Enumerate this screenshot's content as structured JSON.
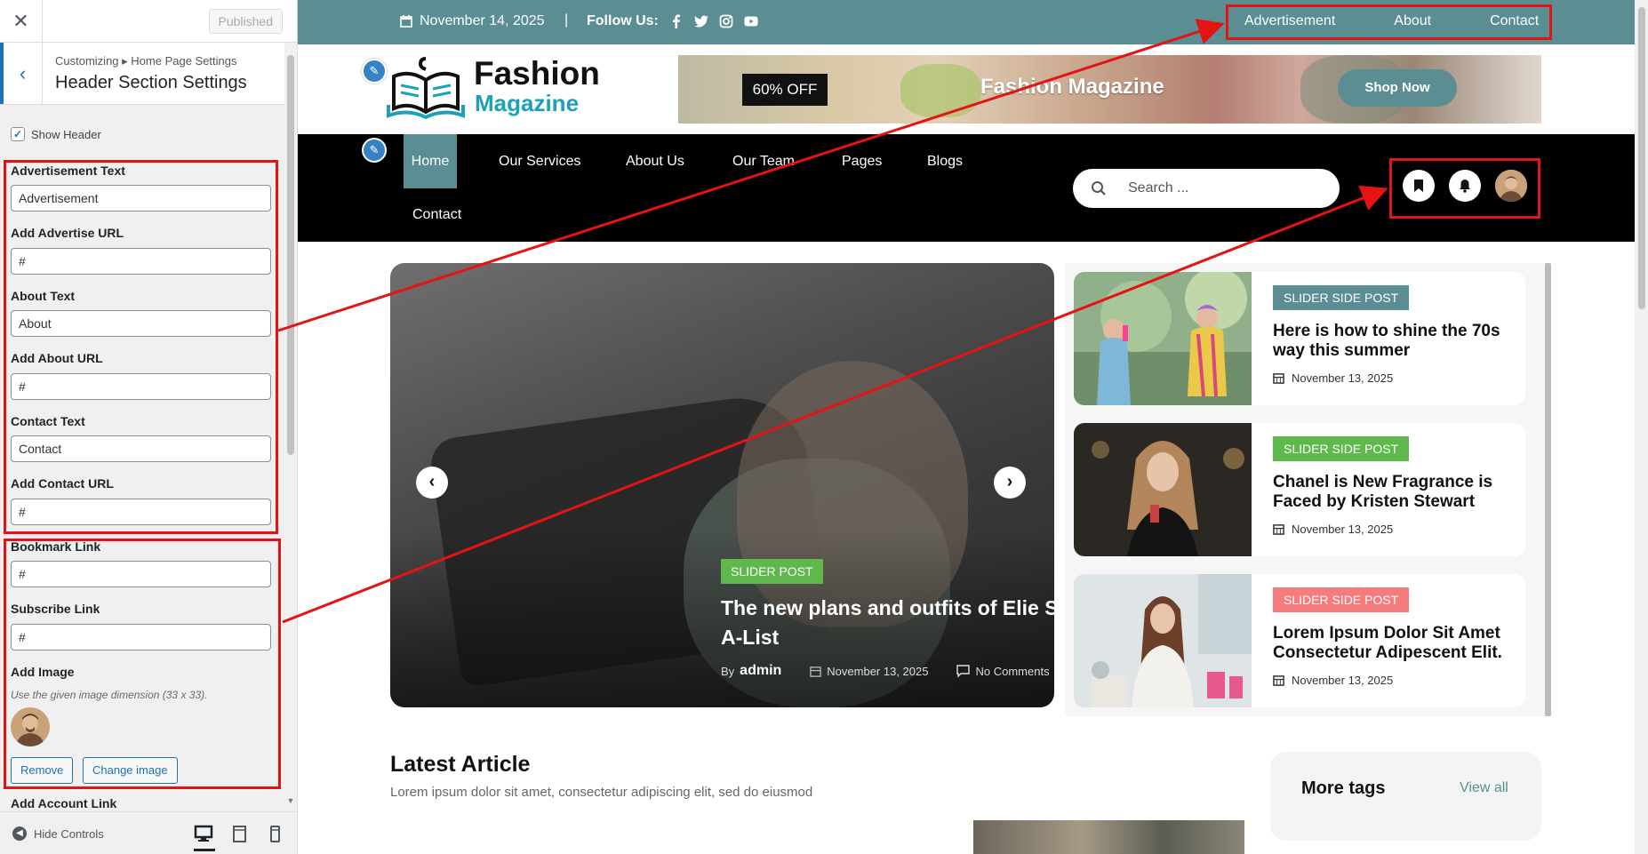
{
  "customizer": {
    "close_icon": "close-icon",
    "published_label": "Published",
    "breadcrumb": "Customizing ▸ Home Page Settings",
    "section_title": "Header Section Settings",
    "show_header_label": "Show Header",
    "fields": {
      "advertisement_text_label": "Advertisement Text",
      "advertisement_text_value": "Advertisement",
      "advertise_url_label": "Add Advertise URL",
      "advertise_url_value": "#",
      "about_text_label": "About Text",
      "about_text_value": "About",
      "about_url_label": "Add About URL",
      "about_url_value": "#",
      "contact_text_label": "Contact Text",
      "contact_text_value": "Contact",
      "contact_url_label": "Add Contact URL",
      "contact_url_value": "#",
      "bookmark_link_label": "Bookmark Link",
      "bookmark_link_value": "#",
      "subscribe_link_label": "Subscribe Link",
      "subscribe_link_value": "#",
      "add_image_label": "Add Image",
      "add_image_desc": "Use the given image dimension (33 x 33).",
      "remove_label": "Remove",
      "change_image_label": "Change image",
      "account_link_label": "Add Account Link"
    },
    "hide_controls_label": "Hide Controls"
  },
  "site": {
    "topbar": {
      "date": "November 14, 2025",
      "separator": "|",
      "follow_label": "Follow Us:",
      "social_icons": [
        "facebook-icon",
        "twitter-icon",
        "instagram-icon",
        "youtube-icon"
      ],
      "links": [
        "Advertisement",
        "About",
        "Contact"
      ],
      "bg_color": "#5a8e92"
    },
    "logo": {
      "title": "Fashion",
      "subtitle": "Magazine"
    },
    "banner": {
      "badge": "60% OFF",
      "title": "Fashion Magazine",
      "button": "Shop Now"
    },
    "nav": {
      "items": [
        "Home",
        "Our Services",
        "About Us",
        "Our Team",
        "Pages",
        "Blogs",
        "Contact"
      ],
      "search_placeholder": "Search ...",
      "icons": [
        "bookmark-icon",
        "bell-icon",
        "user-avatar"
      ]
    },
    "slider": {
      "badge": "SLIDER POST",
      "title": "The new plans and outfits of Elie Saab for the A-List",
      "by": "By",
      "author": "admin",
      "date": "November 13, 2025",
      "comments": "No Comments"
    },
    "side_posts": [
      {
        "badge": "SLIDER SIDE POST",
        "badge_color": "#5a8e92",
        "title": "Here is how to shine the 70s way this summer",
        "date": "November 13, 2025"
      },
      {
        "badge": "SLIDER SIDE POST",
        "badge_color": "#5fb84c",
        "title": "Chanel is New Fragrance is Faced by Kristen Stewart",
        "date": "November 13, 2025"
      },
      {
        "badge": "SLIDER SIDE POST",
        "badge_color": "#f47c7c",
        "title": "Lorem Ipsum Dolor Sit Amet Consectetur Adipescent Elit.",
        "date": "November 13, 2025"
      }
    ],
    "latest": {
      "title": "Latest Article",
      "subtitle": "Lorem ipsum dolor sit amet, consectetur adipiscing elit, sed do eiusmod"
    },
    "tags": {
      "title": "More tags",
      "view_all": "View all"
    }
  }
}
